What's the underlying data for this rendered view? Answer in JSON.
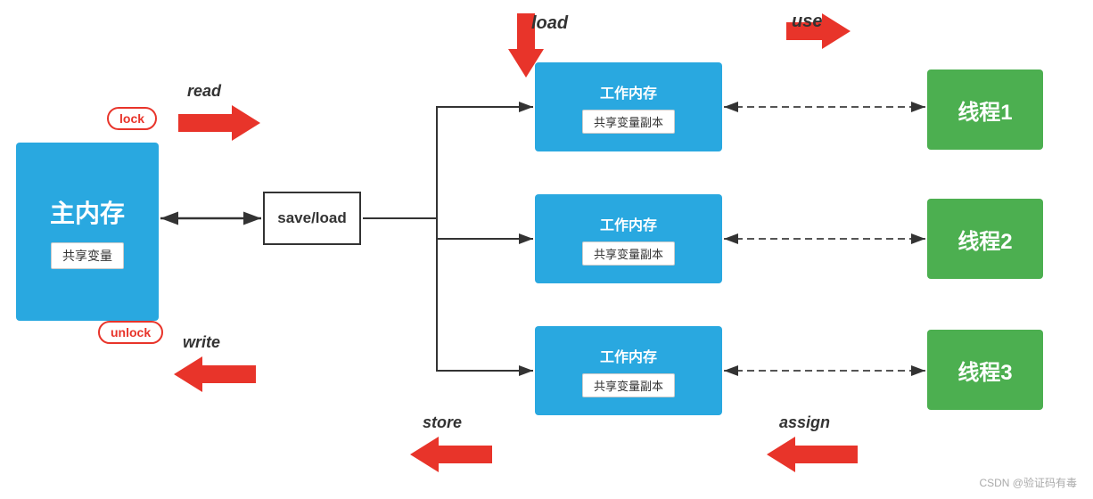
{
  "main_memory": {
    "label": "主内存",
    "shared_var": "共享变量"
  },
  "save_load": {
    "label": "save/load"
  },
  "work_memories": [
    {
      "label": "工作内存",
      "copy": "共享变量副本"
    },
    {
      "label": "工作内存",
      "copy": "共享变量副本"
    },
    {
      "label": "工作内存",
      "copy": "共享变量副本"
    }
  ],
  "threads": [
    {
      "label": "线程1"
    },
    {
      "label": "线程2"
    },
    {
      "label": "线程3"
    }
  ],
  "arrows": {
    "read": "read",
    "write": "write",
    "load": "load",
    "store": "store",
    "use": "use",
    "assign": "assign"
  },
  "badges": {
    "lock": "lock",
    "unlock": "unlock"
  },
  "watermark": "CSDN @验证码有毒"
}
